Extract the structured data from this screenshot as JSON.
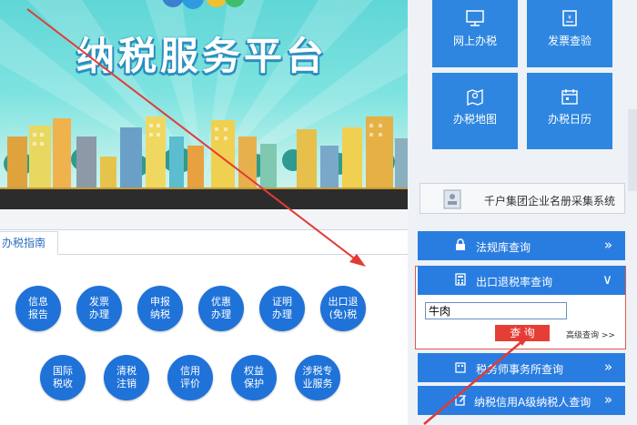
{
  "banner": {
    "title": "纳税服务平台"
  },
  "guide": {
    "tab_label": "办税指南",
    "row1": [
      "信息\n报告",
      "发票\n办理",
      "申报\n纳税",
      "优惠\n办理",
      "证明\n办理",
      "出口退\n(免)税"
    ],
    "row2": [
      "国际\n税收",
      "清税\n注销",
      "信用\n评价",
      "权益\n保护",
      "涉税专\n业服务"
    ]
  },
  "tiles": [
    {
      "label": "网上办税",
      "icon": "monitor-icon"
    },
    {
      "label": "发票查验",
      "icon": "invoice-icon"
    },
    {
      "label": "办税地图",
      "icon": "map-icon"
    },
    {
      "label": "办税日历",
      "icon": "calendar-icon"
    }
  ],
  "enterprise": {
    "label": "千户集团企业名册采集系统"
  },
  "queries": {
    "law": {
      "label": "法规库查询",
      "chevron": "»"
    },
    "export": {
      "label": "出口退税率查询",
      "chevron": "∨"
    },
    "agency": {
      "label": "税务师事务所查询",
      "chevron": "»"
    },
    "credit": {
      "label": "纳税信用A级纳税人查询",
      "chevron": "»"
    }
  },
  "export_search": {
    "value": "牛肉",
    "button": "查 询",
    "advanced": "高级查询 >>"
  },
  "colors": {
    "tile": "#2e86e0",
    "circle": "#1f72d8",
    "query_button": "#e53f35",
    "arrow": "#e53935"
  }
}
